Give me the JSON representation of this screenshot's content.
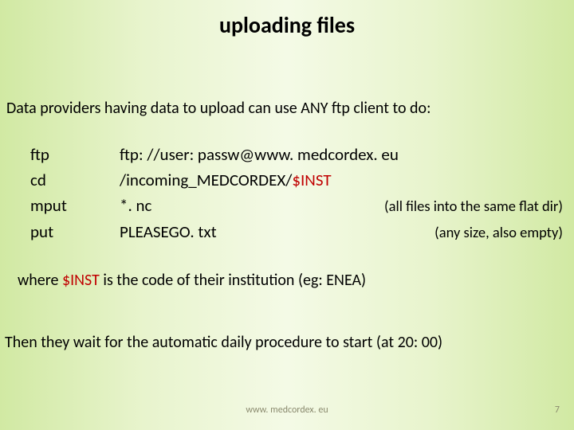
{
  "title": "uploading files",
  "intro": "Data providers having data to upload can use ANY ftp client to do:",
  "commands": {
    "r0": {
      "cmd": "ftp",
      "arg": "ftp: //user: passw@www. medcordex. eu",
      "note": ""
    },
    "r1": {
      "cmd": "cd",
      "arg_prefix": "/incoming_MEDCORDEX/",
      "arg_inst": "$INST",
      "note": ""
    },
    "r2": {
      "cmd": "mput",
      "arg": "*. nc",
      "note": "(all files into the same flat dir)"
    },
    "r3": {
      "cmd": "put",
      "arg": "PLEASEGO. txt",
      "note": "(any size, also empty)"
    }
  },
  "where_prefix": "where ",
  "where_inst": "$INST",
  "where_suffix": " is the code of their institution (eg: ENEA)",
  "then_line": "Then they wait for the automatic daily procedure to start (at 20: 00)",
  "footer_url": "www. medcordex. eu",
  "footer_page": "7"
}
